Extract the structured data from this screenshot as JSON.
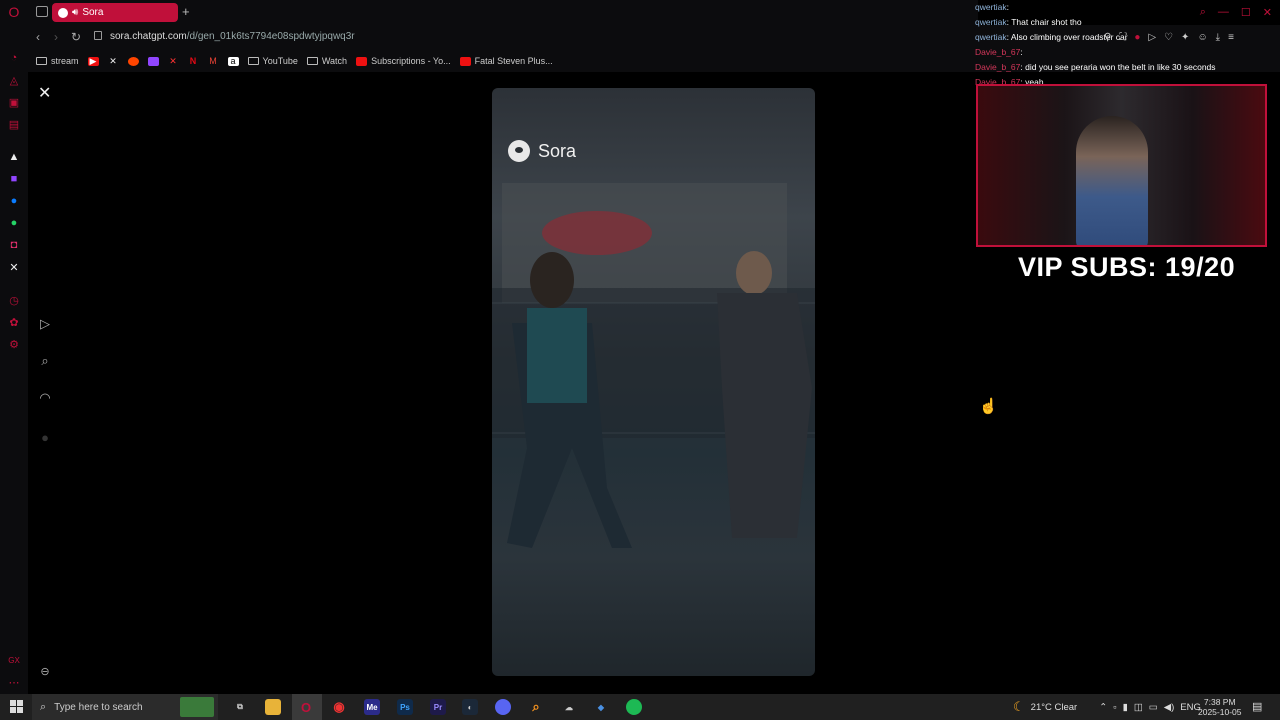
{
  "browser": {
    "tab_title": "Sora",
    "url_domain": "sora.chatgpt.com",
    "url_path": "/d/gen_01k6ts7794e08spdwtyjpqwq3r",
    "bookmarks": [
      "stream",
      "YouTube",
      "Watch",
      "Subscriptions - Yo...",
      "Fatal Steven Plus..."
    ]
  },
  "sora": {
    "logo_text": "Sora"
  },
  "chat": {
    "messages": [
      {
        "user": "qwertiak",
        "text": ""
      },
      {
        "user": "qwertiak",
        "text": "That chair shot tho"
      },
      {
        "user": "qwertiak",
        "text": "Also climbing over roadster car"
      },
      {
        "user": "Davie_b_67",
        "text": ""
      },
      {
        "user": "Davie_b_67",
        "text": "did you see peraria won the belt in like 30 seconds"
      },
      {
        "user": "Davie_b_67",
        "text": "yeah"
      }
    ]
  },
  "overlay": {
    "vip_text": "VIP SUBS: 19/20"
  },
  "taskbar": {
    "search_placeholder": "Type here to search",
    "weather": "21°C  Clear",
    "lang": "ENG",
    "time": "7:38 PM",
    "date": "2025-10-05"
  },
  "colors": {
    "accent": "#c0103a",
    "taskbar": "#202020"
  }
}
